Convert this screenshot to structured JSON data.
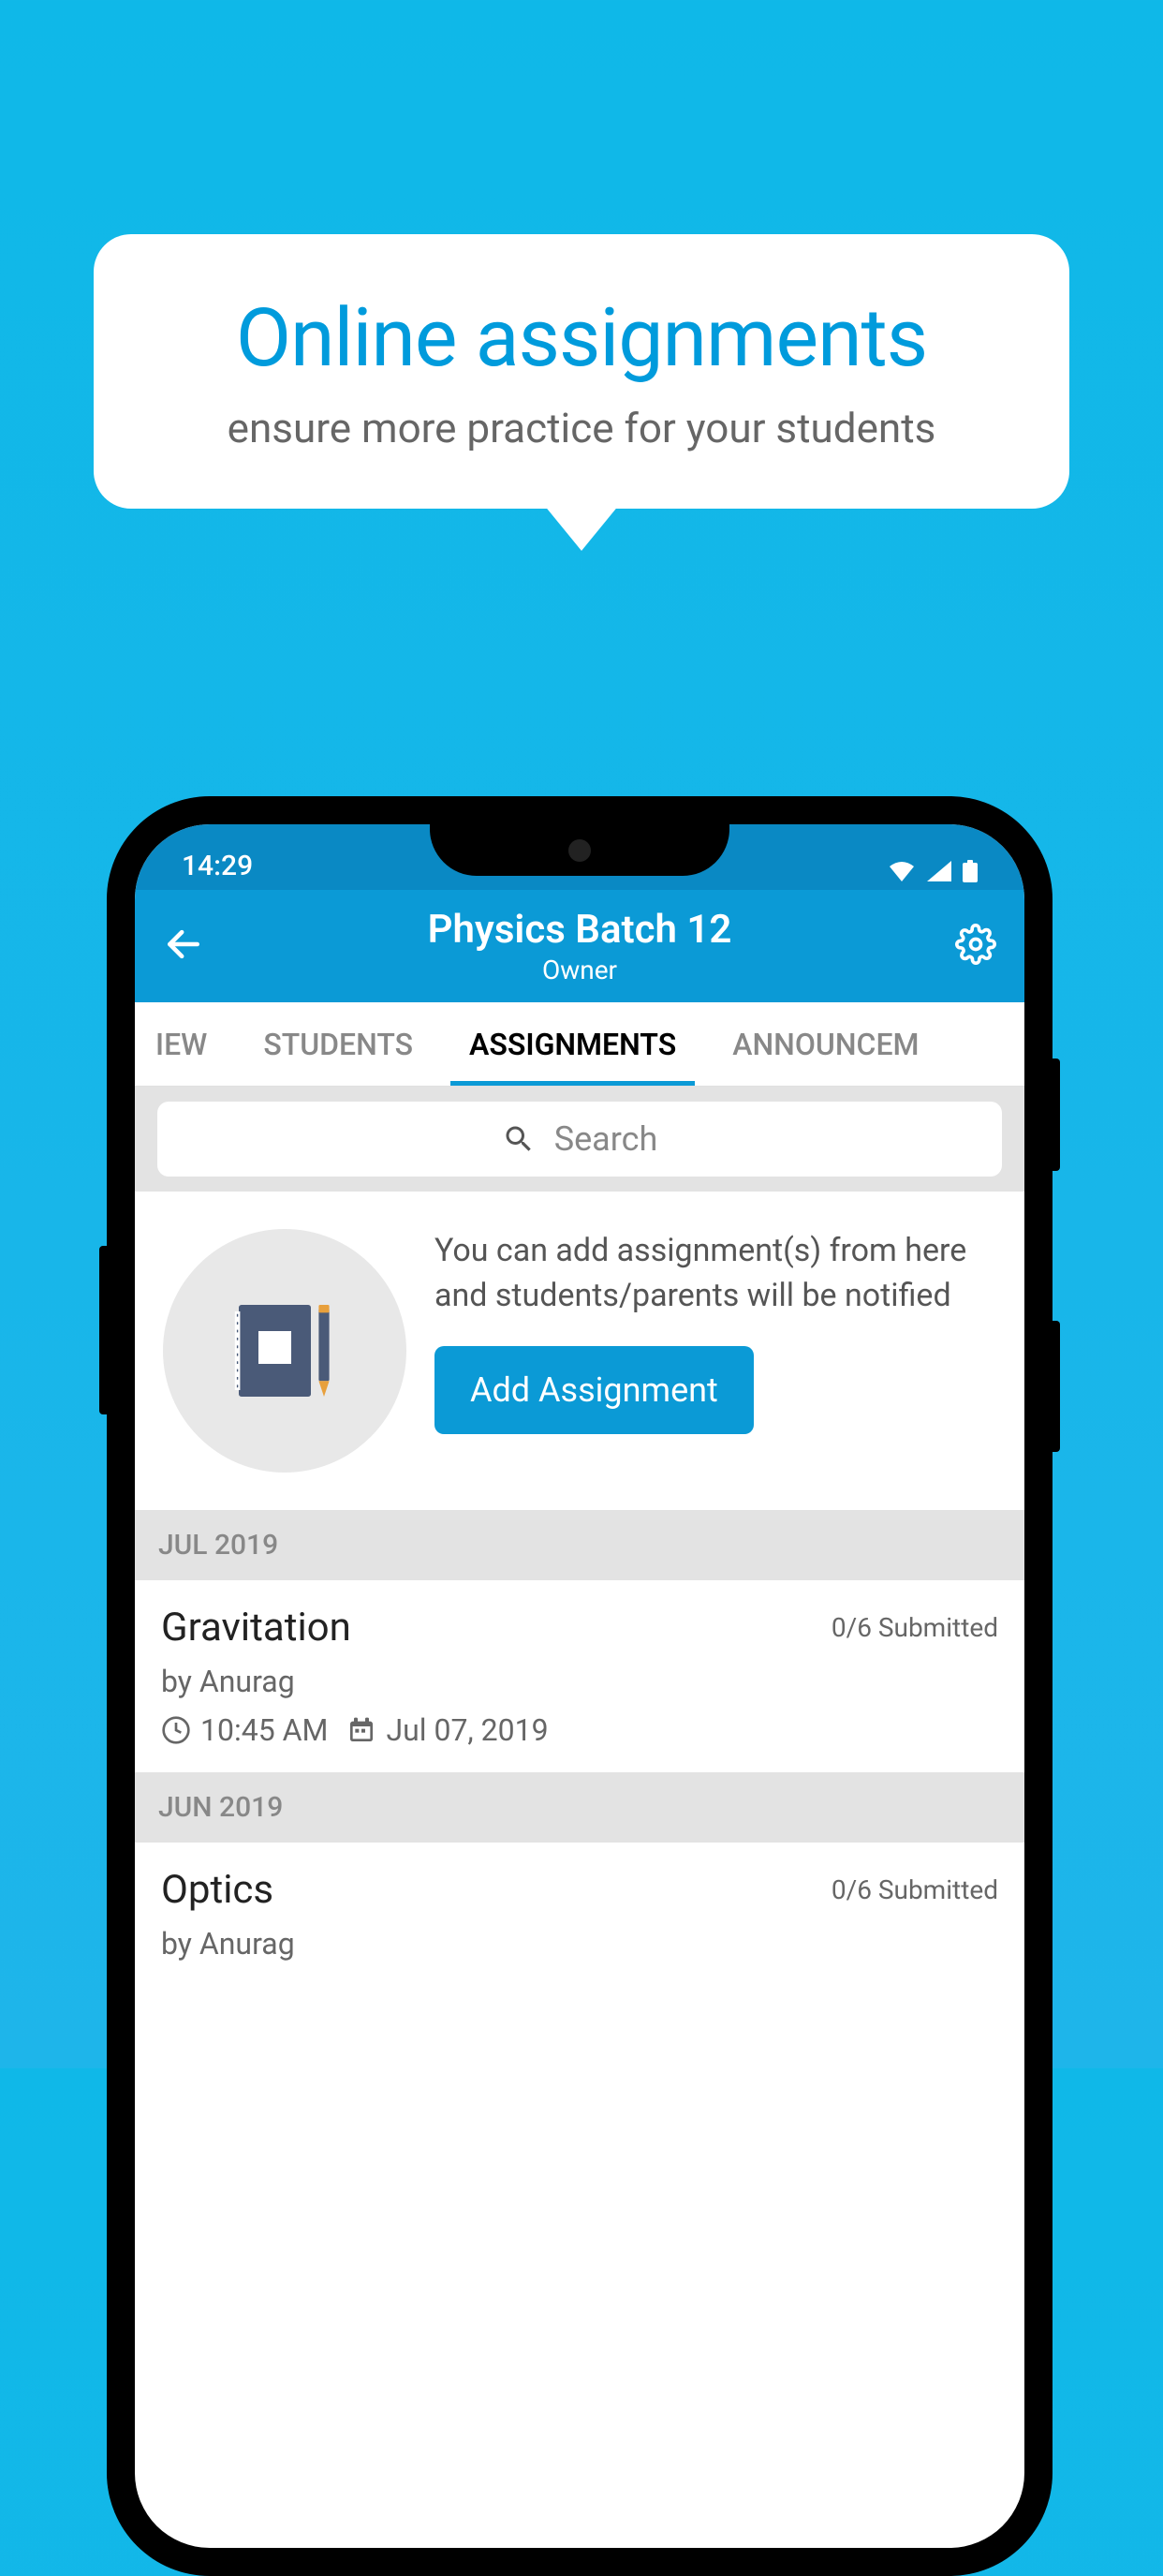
{
  "promo": {
    "title": "Online assignments",
    "subtitle": "ensure more practice for your students"
  },
  "status_bar": {
    "time": "14:29"
  },
  "header": {
    "title": "Physics Batch 12",
    "subtitle": "Owner"
  },
  "tabs": {
    "partial_left": "IEW",
    "students": "STUDENTS",
    "assignments": "ASSIGNMENTS",
    "partial_right": "ANNOUNCEM"
  },
  "search": {
    "placeholder": "Search"
  },
  "info_card": {
    "text": "You can add assignment(s) from here and students/parents will be notified",
    "button_label": "Add Assignment"
  },
  "sections": [
    {
      "month": "JUL 2019",
      "items": [
        {
          "title": "Gravitation",
          "status": "0/6 Submitted",
          "by": "by Anurag",
          "time": "10:45 AM",
          "date": "Jul 07, 2019"
        }
      ]
    },
    {
      "month": "JUN 2019",
      "items": [
        {
          "title": "Optics",
          "status": "0/6 Submitted",
          "by": "by Anurag",
          "time": "",
          "date": ""
        }
      ]
    }
  ]
}
